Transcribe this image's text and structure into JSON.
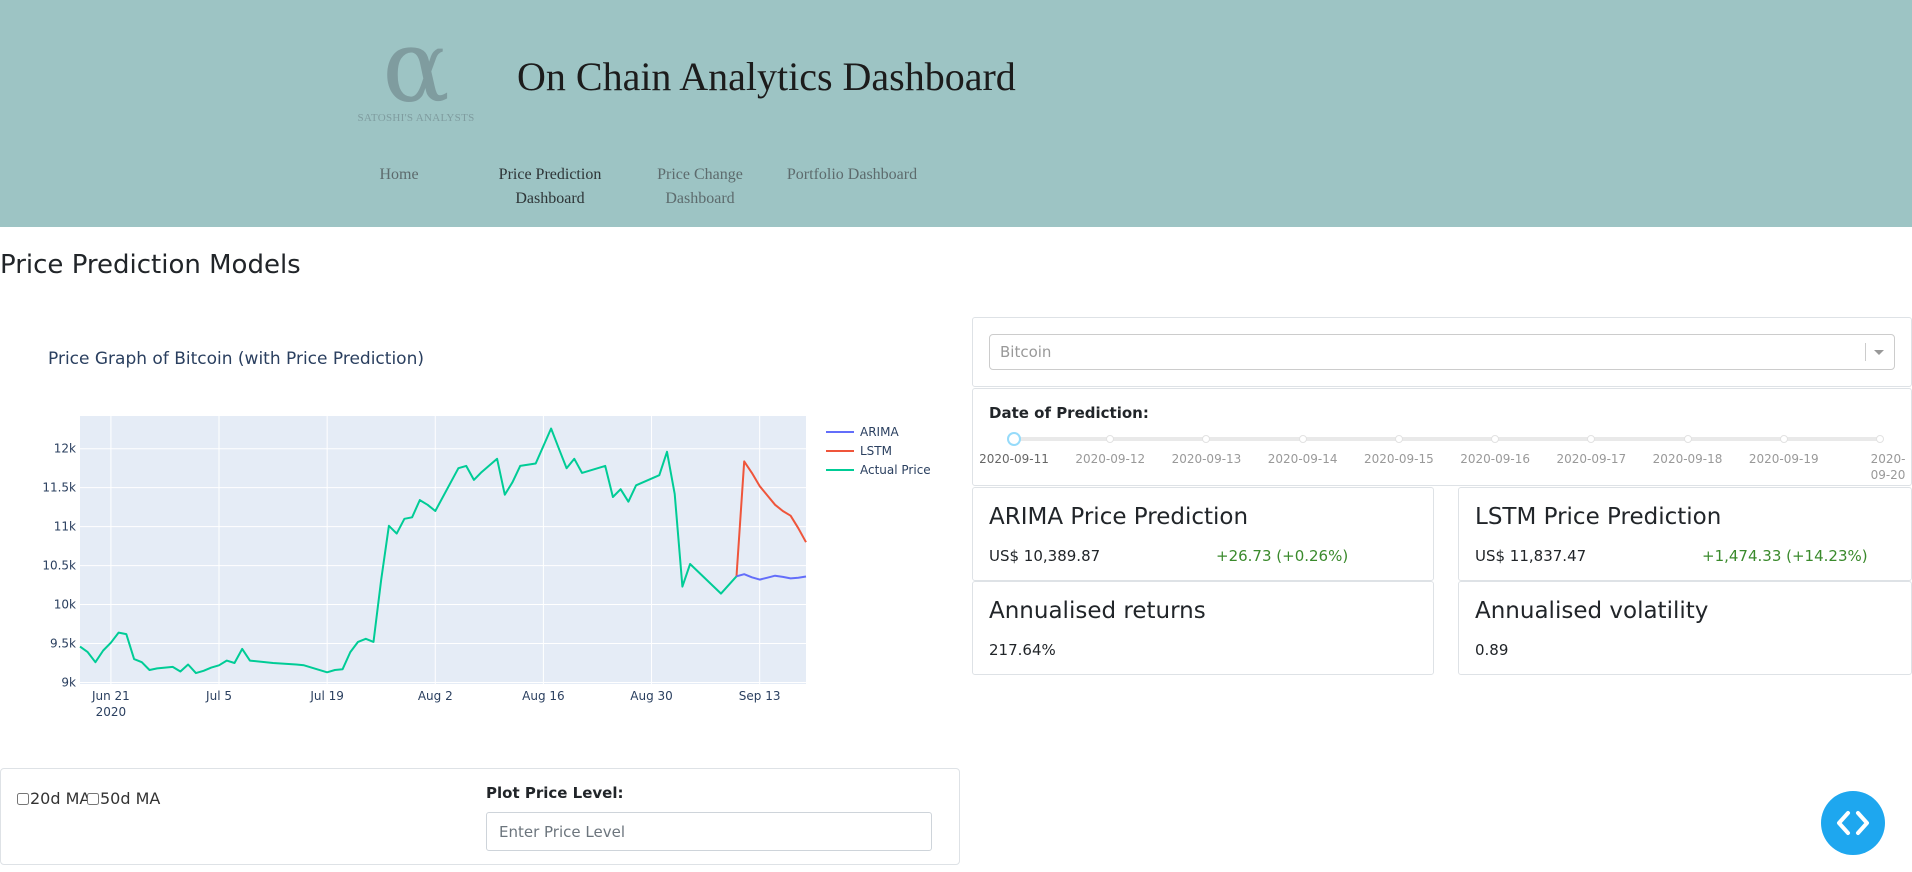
{
  "header": {
    "logo_letter": "α",
    "logo_tagline": "SATOSHI'S ANALYSTS",
    "title": "On Chain Analytics Dashboard",
    "nav": [
      {
        "label": "Home"
      },
      {
        "label": "Price Prediction Dashboard"
      },
      {
        "label": "Price Change Dashboard"
      },
      {
        "label": "Portfolio Dashboard"
      }
    ]
  },
  "page": {
    "title": "Price Prediction Models"
  },
  "chart_data": {
    "type": "line",
    "title": "Price Graph of Bitcoin (with Price Prediction)",
    "xlabel": "",
    "ylabel": "",
    "x_ticks": [
      "Jun 21",
      "Jul 5",
      "Jul 19",
      "Aug 2",
      "Aug 16",
      "Aug 30",
      "Sep 13"
    ],
    "x_tick_subtitle": "2020",
    "y_ticks": [
      "9k",
      "9.5k",
      "10k",
      "10.5k",
      "11k",
      "11.5k",
      "12k"
    ],
    "xlim": [
      "2020-06-17",
      "2020-09-19"
    ],
    "ylim": [
      8980,
      12420
    ],
    "grid": true,
    "legend_position": "top-right",
    "plot_bg": "#e5ecf6",
    "series": [
      {
        "name": "ARIMA",
        "color": "#636efa",
        "x": [
          "2020-09-10",
          "2020-09-11",
          "2020-09-12",
          "2020-09-13",
          "2020-09-14",
          "2020-09-15",
          "2020-09-16",
          "2020-09-17",
          "2020-09-18",
          "2020-09-19"
        ],
        "y": [
          10363,
          10390,
          10350,
          10320,
          10345,
          10370,
          10355,
          10335,
          10345,
          10360
        ]
      },
      {
        "name": "LSTM",
        "color": "#ef553b",
        "x": [
          "2020-09-10",
          "2020-09-11",
          "2020-09-12",
          "2020-09-13",
          "2020-09-14",
          "2020-09-15",
          "2020-09-16",
          "2020-09-17",
          "2020-09-18",
          "2020-09-19"
        ],
        "y": [
          10363,
          11837,
          11690,
          11520,
          11400,
          11280,
          11200,
          11140,
          10980,
          10800
        ]
      },
      {
        "name": "Actual Price",
        "color": "#00cc96",
        "x": [
          "2020-06-17",
          "2020-06-18",
          "2020-06-19",
          "2020-06-20",
          "2020-06-21",
          "2020-06-22",
          "2020-06-23",
          "2020-06-24",
          "2020-06-25",
          "2020-06-26",
          "2020-06-27",
          "2020-06-28",
          "2020-06-29",
          "2020-06-30",
          "2020-07-01",
          "2020-07-02",
          "2020-07-03",
          "2020-07-04",
          "2020-07-05",
          "2020-07-06",
          "2020-07-07",
          "2020-07-08",
          "2020-07-09",
          "2020-07-12",
          "2020-07-15",
          "2020-07-16",
          "2020-07-19",
          "2020-07-20",
          "2020-07-21",
          "2020-07-22",
          "2020-07-23",
          "2020-07-24",
          "2020-07-25",
          "2020-07-26",
          "2020-07-27",
          "2020-07-28",
          "2020-07-29",
          "2020-07-30",
          "2020-07-31",
          "2020-08-01",
          "2020-08-02",
          "2020-08-05",
          "2020-08-06",
          "2020-08-07",
          "2020-08-08",
          "2020-08-10",
          "2020-08-11",
          "2020-08-12",
          "2020-08-13",
          "2020-08-15",
          "2020-08-17",
          "2020-08-18",
          "2020-08-19",
          "2020-08-20",
          "2020-08-21",
          "2020-08-24",
          "2020-08-25",
          "2020-08-26",
          "2020-08-27",
          "2020-08-28",
          "2020-08-31",
          "2020-09-01",
          "2020-09-02",
          "2020-09-03",
          "2020-09-04",
          "2020-09-08",
          "2020-09-10"
        ],
        "y": [
          9460,
          9390,
          9260,
          9410,
          9510,
          9640,
          9620,
          9300,
          9260,
          9160,
          9180,
          9190,
          9200,
          9140,
          9230,
          9120,
          9150,
          9190,
          9220,
          9280,
          9250,
          9430,
          9280,
          9250,
          9230,
          9220,
          9130,
          9160,
          9170,
          9390,
          9520,
          9560,
          9520,
          10320,
          11010,
          10910,
          11100,
          11120,
          11340,
          11280,
          11200,
          11750,
          11780,
          11600,
          11700,
          11870,
          11410,
          11570,
          11780,
          11810,
          12260,
          12000,
          11750,
          11870,
          11690,
          11780,
          11380,
          11480,
          11320,
          11530,
          11660,
          11960,
          11420,
          10230,
          10520,
          10140,
          10363
        ]
      }
    ]
  },
  "controls": {
    "ma20_label": "20d MA",
    "ma50_label": "50d MA",
    "plot_price_label": "Plot Price Level:",
    "price_placeholder": "Enter Price Level"
  },
  "coin_dropdown": {
    "value": "Bitcoin"
  },
  "date_slider": {
    "label": "Date of Prediction:",
    "selected": "2020-09-11",
    "marks": [
      {
        "label": "2020-09-11"
      },
      {
        "label": "2020-09-12"
      },
      {
        "label": "2020-09-13"
      },
      {
        "label": "2020-09-14"
      },
      {
        "label": "2020-09-15"
      },
      {
        "label": "2020-09-16"
      },
      {
        "label": "2020-09-17"
      },
      {
        "label": "2020-09-18"
      },
      {
        "label": "2020-09-19"
      },
      {
        "label": "2020-09-20"
      }
    ]
  },
  "cards": {
    "arima": {
      "title": "ARIMA Price Prediction",
      "value": "US$ 10,389.87",
      "change": "+26.73 (+0.26%)"
    },
    "lstm": {
      "title": "LSTM Price Prediction",
      "value": "US$ 11,837.47",
      "change": "+1,474.33 (+14.23%)"
    },
    "returns": {
      "title": "Annualised returns",
      "value": "217.64%"
    },
    "volatility": {
      "title": "Annualised volatility",
      "value": "0.89"
    }
  },
  "colors": {
    "header_bg": "#9dc4c4",
    "positive": "#3a8a2c",
    "fab": "#1ea7ef"
  },
  "fab_icon": "code-icon"
}
